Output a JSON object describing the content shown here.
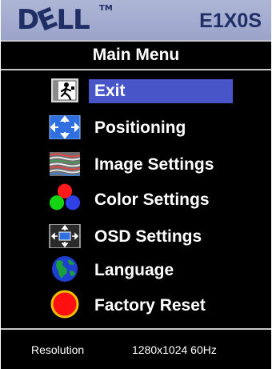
{
  "header": {
    "brand": "DELL",
    "brand_d": "D",
    "brand_e": "E",
    "brand_ll": "LL",
    "trademark": "TM",
    "model": "E1X0S"
  },
  "menu": {
    "title": "Main Menu",
    "items": [
      {
        "label": "Exit",
        "icon": "exit-icon",
        "selected": true
      },
      {
        "label": "Positioning",
        "icon": "positioning-icon",
        "selected": false
      },
      {
        "label": "Image Settings",
        "icon": "image-settings-icon",
        "selected": false
      },
      {
        "label": "Color Settings",
        "icon": "color-settings-icon",
        "selected": false
      },
      {
        "label": "OSD Settings",
        "icon": "osd-settings-icon",
        "selected": false
      },
      {
        "label": "Language",
        "icon": "globe-icon",
        "selected": false
      },
      {
        "label": "Factory Reset",
        "icon": "factory-reset-icon",
        "selected": false
      }
    ]
  },
  "footer": {
    "resolution_label": "Resolution",
    "resolution_value": "1280x1024 60Hz"
  },
  "colors": {
    "header_bg": "#aeb6d6",
    "brand": "#1f2f66",
    "background": "#000000",
    "selection": "#4855c9",
    "text": "#ffffff"
  }
}
